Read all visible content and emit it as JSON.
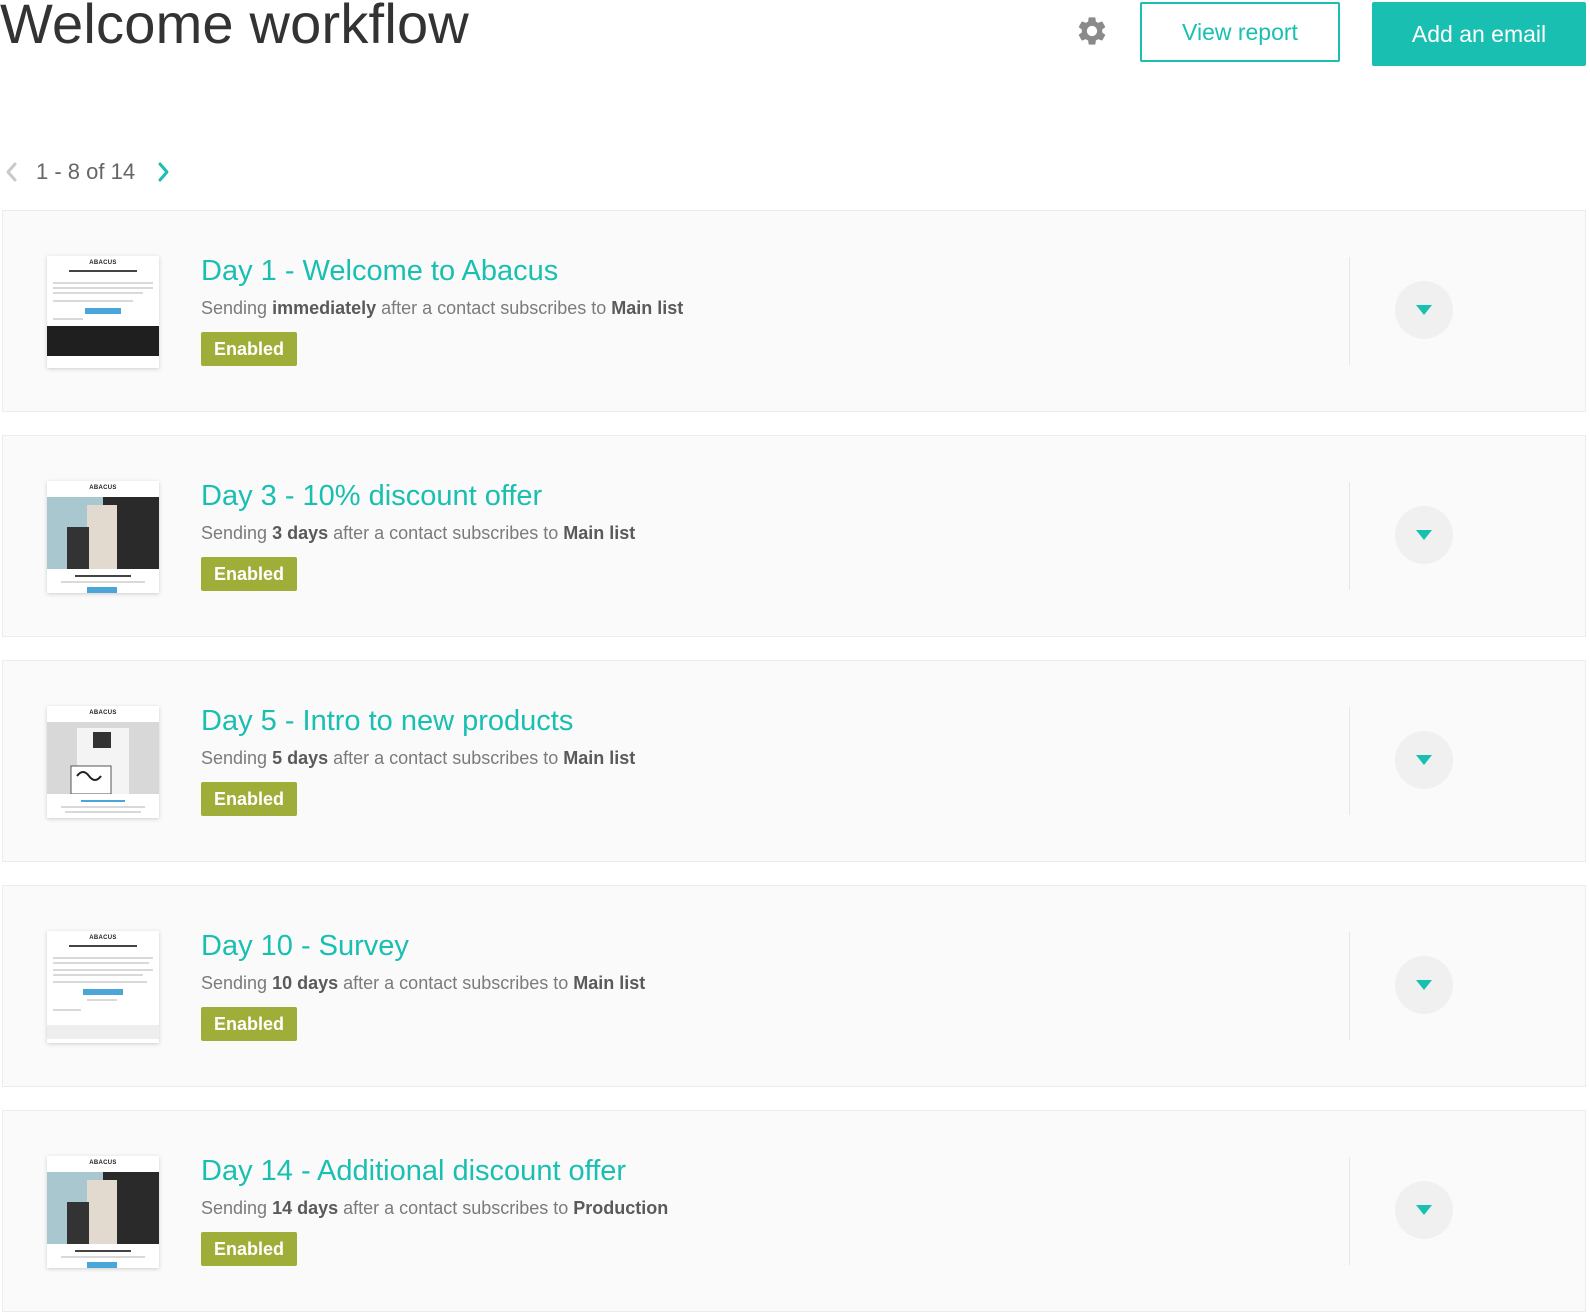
{
  "header": {
    "title": "Welcome workflow",
    "view_report_label": "View report",
    "add_email_label": "Add an email"
  },
  "pagination": {
    "range_text": "1 - 8 of 14"
  },
  "colors": {
    "accent": "#19bfb0",
    "status_enabled": "#9fae39"
  },
  "icons": {
    "settings": "gear-icon",
    "prev": "chevron-left-icon",
    "next": "chevron-right-icon",
    "expand": "caret-down-icon"
  },
  "emails": [
    {
      "title": "Day 1 - Welcome to Abacus",
      "desc_pre": "Sending",
      "timing": "immediately",
      "desc_mid": "after a contact subscribes to",
      "list": "Main list",
      "status": "Enabled",
      "thumb_brand": "ABACUS"
    },
    {
      "title": "Day 3 - 10% discount offer",
      "desc_pre": "Sending",
      "timing": "3 days",
      "desc_mid": "after a contact subscribes to",
      "list": "Main list",
      "status": "Enabled",
      "thumb_brand": "ABACUS"
    },
    {
      "title": "Day 5 - Intro to new products",
      "desc_pre": "Sending",
      "timing": "5 days",
      "desc_mid": "after a contact subscribes to",
      "list": "Main list",
      "status": "Enabled",
      "thumb_brand": "ABACUS"
    },
    {
      "title": "Day 10 - Survey",
      "desc_pre": "Sending",
      "timing": "10 days",
      "desc_mid": "after a contact subscribes to",
      "list": "Main list",
      "status": "Enabled",
      "thumb_brand": "ABACUS"
    },
    {
      "title": "Day 14 - Additional discount offer",
      "desc_pre": "Sending",
      "timing": "14 days",
      "desc_mid": "after a contact subscribes to",
      "list": "Production",
      "status": "Enabled",
      "thumb_brand": "ABACUS"
    }
  ]
}
